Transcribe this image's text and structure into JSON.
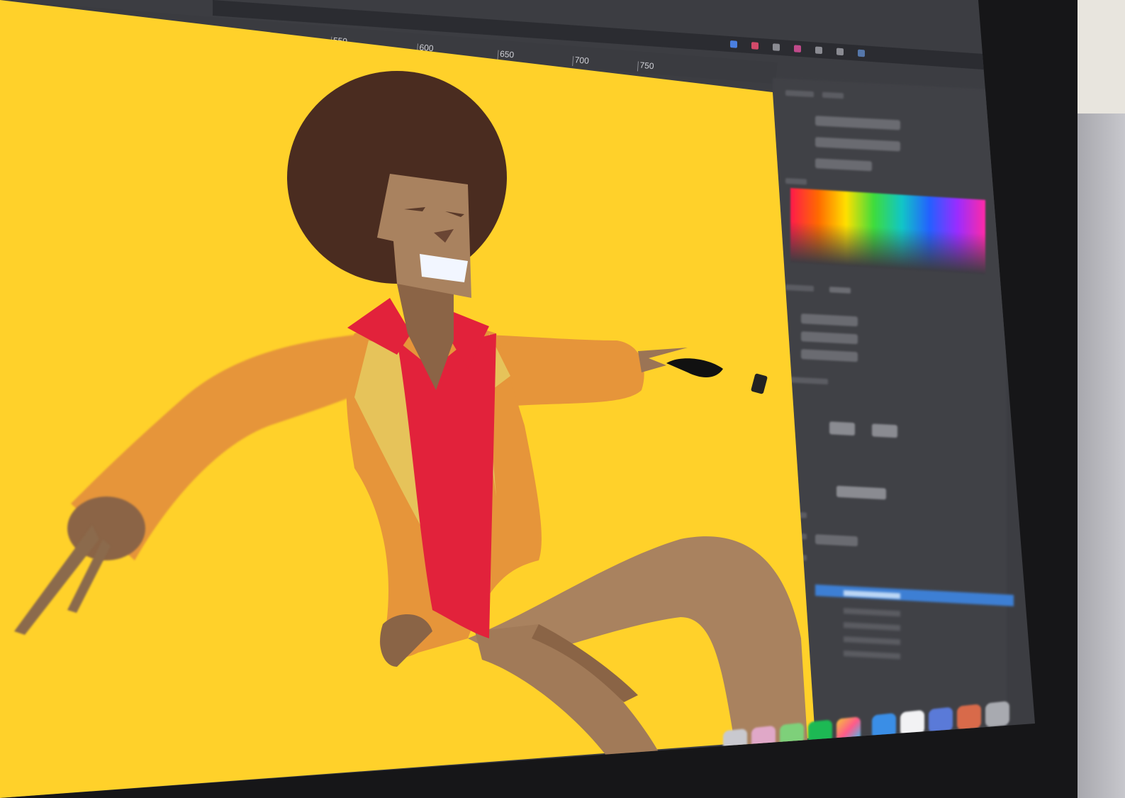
{
  "ruler": {
    "labels": [
      "550",
      "600",
      "650",
      "700",
      "750"
    ]
  },
  "panel": {
    "color_ramp": "color-picker",
    "layers": [
      "layer",
      "layer",
      "layer",
      "layer",
      "layer"
    ]
  },
  "colors": {
    "canvas": "#ffd12a",
    "hair": "#4a2c20",
    "skin": "#a9825f",
    "jacket": "#e6953a",
    "shirt": "#e2223b",
    "lapel": "#e6c35a",
    "teeth": "#f2f6ff",
    "panel": "#404146",
    "selection": "#3d7fd4"
  },
  "dock": {
    "icons": [
      "finder-icon",
      "safari-icon",
      "messages-icon",
      "spotify-icon",
      "photos-icon",
      "app-icon",
      "app-icon",
      "app-icon",
      "app-icon",
      "trash-icon"
    ]
  }
}
